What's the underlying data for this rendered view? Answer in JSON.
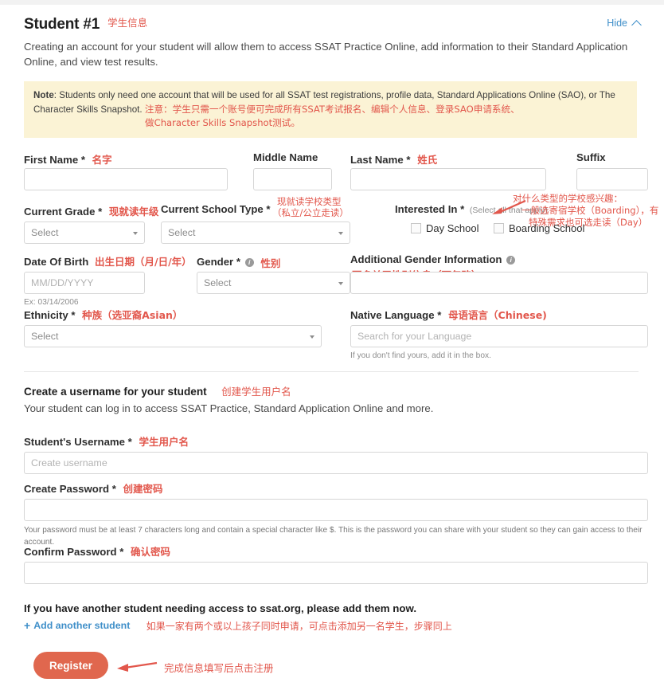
{
  "header": {
    "title": "Student #1",
    "title_annotation": "学生信息",
    "hide_label": "Hide",
    "hide_icon": "chevron-up-icon",
    "intro": "Creating an account for your student will allow them to access SSAT Practice Online, add information to their Standard Application Online, and view test results."
  },
  "note": {
    "label": "Note",
    "text": ": Students only need one account that will be used for all SSAT test registrations, profile data, Standard Applications Online (SAO), or The Character Skills Snapshot.",
    "annotation_line1": "注意：学生只需一个账号便可完成所有SSAT考试报名、编辑个人信息、登录SAO申请系统、",
    "annotation_line2": "做Character Skills Snapshot测试。"
  },
  "fields": {
    "first_name": {
      "label": "First Name",
      "required": "*",
      "annotation": "名字",
      "value": "",
      "placeholder": ""
    },
    "middle_name": {
      "label": "Middle Name",
      "required": "",
      "annotation": "",
      "value": "",
      "placeholder": ""
    },
    "last_name": {
      "label": "Last Name",
      "required": "*",
      "annotation": "姓氏",
      "value": "",
      "placeholder": ""
    },
    "suffix": {
      "label": "Suffix",
      "required": "",
      "annotation": "",
      "value": "",
      "placeholder": ""
    },
    "current_grade": {
      "label": "Current Grade",
      "required": "*",
      "annotation": "现就读年级",
      "selected": "Select"
    },
    "current_school_type": {
      "label": "Current School Type",
      "required": "*",
      "annotation_line1": "现就读学校类型",
      "annotation_line2": "（私立/公立走读）",
      "selected": "Select"
    },
    "interested_in": {
      "label": "Interested In",
      "required": "*",
      "hint": "(Select all that apply)",
      "annotation_line1": "对什么类型的学校感兴趣：",
      "annotation_line2": "一般选寄宿学校（Boarding），有",
      "annotation_line3": "特殊需求也可选走读（Day）",
      "options": [
        {
          "label": "Day School",
          "checked": false
        },
        {
          "label": "Boarding School",
          "checked": false
        }
      ]
    },
    "date_of_birth": {
      "label": "Date Of Birth",
      "required": "",
      "annotation": "出生日期（月/日/年）",
      "placeholder": "MM/DD/YYYY",
      "value": "",
      "example": "Ex: 03/14/2006"
    },
    "gender": {
      "label": "Gender",
      "required": "*",
      "info_icon": "info-icon",
      "annotation": "性别",
      "selected": "Select"
    },
    "additional_gender": {
      "label": "Additional Gender Information",
      "required": "",
      "info_icon": "info-icon",
      "annotation": "更多关于性别信息（可忽略）",
      "value": "",
      "placeholder": ""
    },
    "ethnicity": {
      "label": "Ethnicity",
      "required": "*",
      "annotation": "种族（选亚裔Asian）",
      "selected": "Select"
    },
    "native_language": {
      "label": "Native Language",
      "required": "*",
      "annotation": "母语语言（Chinese)",
      "placeholder": "Search for your Language",
      "value": "",
      "hint": "If you don't find yours, add it in the box."
    }
  },
  "username_section": {
    "heading": "Create a username for your student",
    "heading_annotation": "创建学生用户名",
    "subheading": "Your student can log in to access SSAT Practice, Standard Application Online and more.",
    "username": {
      "label": "Student's Username",
      "required": "*",
      "annotation": "学生用户名",
      "placeholder": "Create username",
      "value": ""
    },
    "password": {
      "label": "Create Password",
      "required": "*",
      "annotation": "创建密码",
      "value": "",
      "placeholder": ""
    },
    "password_hint": "Your password must be at least 7 characters long and contain a special character like $. This is the password you can share with your student so they can gain access to their account.",
    "confirm_password": {
      "label": "Confirm Password",
      "required": "*",
      "annotation": "确认密码",
      "value": "",
      "placeholder": ""
    }
  },
  "footer": {
    "another_student_text": "If you have another student needing access to ssat.org, please add them now.",
    "add_link": "Add another student",
    "add_icon": "plus-icon",
    "add_annotation": "如果一家有两个或以上孩子同时申请，可点击添加另一名学生，步骤同上",
    "register_label": "Register",
    "register_annotation": "完成信息填写后点击注册"
  },
  "colors": {
    "annotation_red": "#e2574c",
    "link_blue": "#3f8fc9",
    "register_orange": "#e0674e",
    "note_bg": "#fbf3d5"
  }
}
